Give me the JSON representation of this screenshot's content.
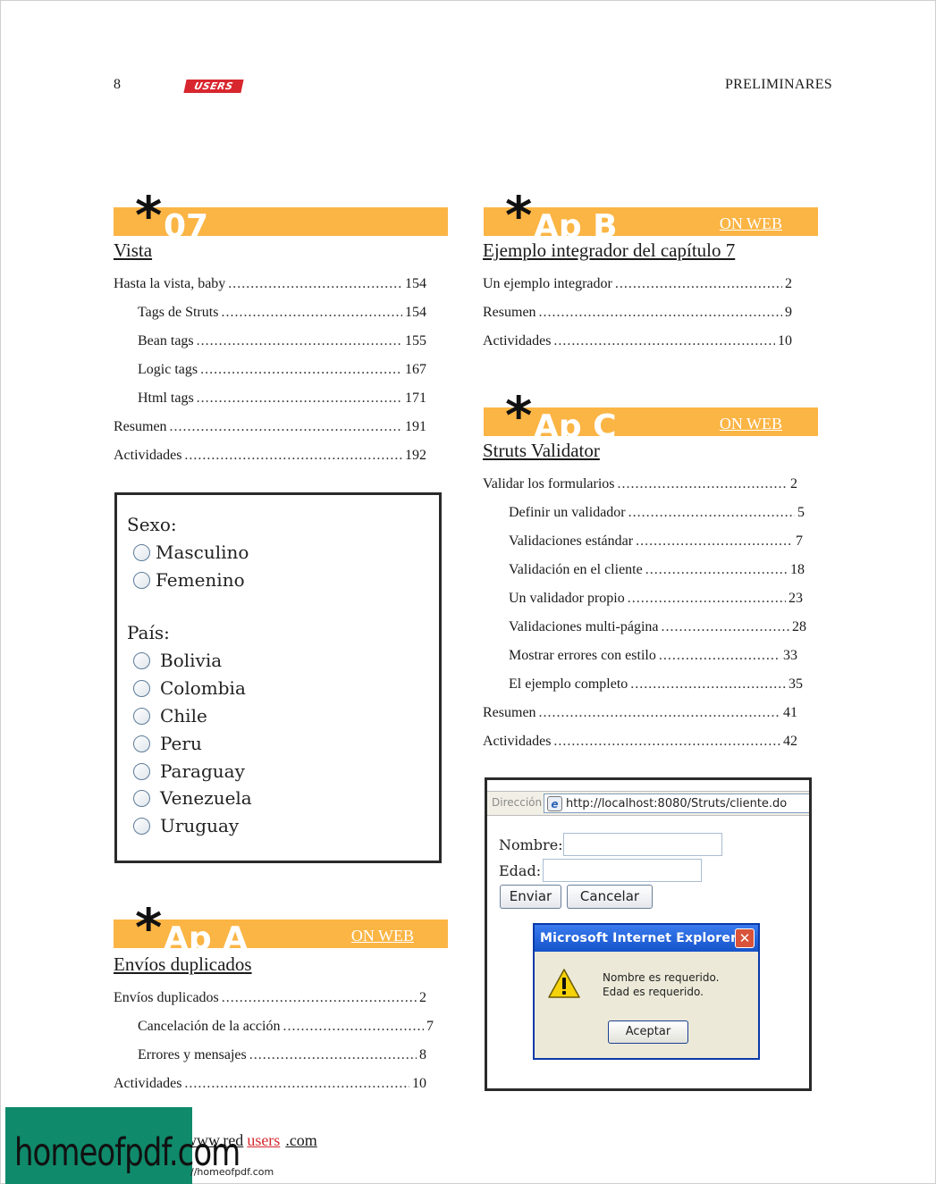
{
  "header": {
    "page_number": "8",
    "logo_text": "USERS",
    "section": "PRELIMINARES"
  },
  "colors": {
    "accent": "#fbb545",
    "logo_red": "#d8262e",
    "watermark_green": "#0f8a6b"
  },
  "chapters": {
    "c07": {
      "number": "07",
      "title": "Vista",
      "entries": [
        {
          "text": "Hasta la vista, baby",
          "page": "154"
        },
        {
          "text": "Tags de Struts",
          "page": "154"
        },
        {
          "text": "Bean tags",
          "page": "155"
        },
        {
          "text": "Logic tags",
          "page": "167"
        },
        {
          "text": "Html tags",
          "page": "171"
        },
        {
          "text": "Resumen",
          "page": "191"
        },
        {
          "text": "Actividades",
          "page": "192"
        }
      ]
    },
    "apA": {
      "number": "Ap A",
      "badge": "ON WEB",
      "title": "Envíos duplicados",
      "entries": [
        {
          "text": "Envíos duplicados",
          "page": "2"
        },
        {
          "text": "Cancelación de la acción",
          "page": "7"
        },
        {
          "text": "Errores y mensajes",
          "page": "8"
        },
        {
          "text": "Actividades",
          "page": "10"
        }
      ]
    },
    "apB": {
      "number": "Ap B",
      "badge": "ON WEB",
      "title": "Ejemplo integrador del capítulo 7",
      "entries": [
        {
          "text": "Un ejemplo integrador",
          "page": "2"
        },
        {
          "text": "Resumen",
          "page": "9"
        },
        {
          "text": "Actividades",
          "page": "10"
        }
      ]
    },
    "apC": {
      "number": "Ap C",
      "badge": "ON WEB",
      "title": "Struts Validator",
      "entries": [
        {
          "text": "Validar los formularios",
          "page": "2"
        },
        {
          "text": "Definir un validador",
          "page": "5"
        },
        {
          "text": "Validaciones estándar",
          "page": "7"
        },
        {
          "text": "Validación en el cliente",
          "page": "18"
        },
        {
          "text": "Un validador propio",
          "page": "23"
        },
        {
          "text": "Validaciones multi-página",
          "page": "28"
        },
        {
          "text": "Mostrar errores con estilo",
          "page": "33"
        },
        {
          "text": "El ejemplo completo",
          "page": "35"
        },
        {
          "text": "Resumen",
          "page": "41"
        },
        {
          "text": "Actividades",
          "page": "42"
        }
      ]
    }
  },
  "radio_figure": {
    "sexo_label": "Sexo:",
    "sexo_options": [
      "Masculino",
      "Femenino"
    ],
    "pais_label": "País:",
    "pais_options": [
      "Bolivia",
      "Colombia",
      "Chile",
      "Peru",
      "Paraguay",
      "Venezuela",
      "Uruguay"
    ]
  },
  "browser_figure": {
    "address_label": "Dirección",
    "url": "http://localhost:8080/Struts/cliente.do",
    "nombre_label": "Nombre:",
    "edad_label": "Edad:",
    "enviar_button": "Enviar",
    "cancelar_button": "Cancelar",
    "dialog": {
      "title": "Microsoft Internet Explorer",
      "close_glyph": "✕",
      "line1": "Nombre es requerido.",
      "line2": "Edad es requerido.",
      "ok_button": "Aceptar"
    }
  },
  "footer": {
    "url_prefix": "www.red",
    "url_brand": "users",
    "url_suffix": ".com"
  },
  "watermark": {
    "label": "homeofpdf.com",
    "url": "//homeofpdf.com"
  }
}
